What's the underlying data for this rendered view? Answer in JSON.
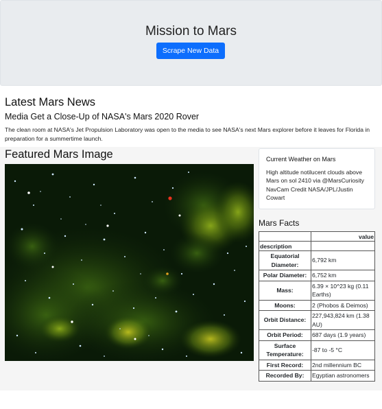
{
  "header": {
    "title": "Mission to Mars",
    "scrape_button": "Scrape New Data"
  },
  "news": {
    "heading": "Latest Mars News",
    "title": "Media Get a Close-Up of NASA's Mars 2020 Rover",
    "paragraph": "The clean room at NASA's Jet Propulsion Laboratory was open to the media to see NASA's next Mars explorer before it leaves for Florida in preparation for a summertime launch."
  },
  "featured": {
    "heading": "Featured Mars Image"
  },
  "weather": {
    "title": "Current Weather on Mars",
    "text": "High altitude notilucent clouds above Mars on sol 2410 via @MarsCuriosity NavCam Credit NASA/JPL/Justin Cowart"
  },
  "facts": {
    "heading": "Mars Facts",
    "col_value": "value",
    "col_description": "description",
    "rows": [
      {
        "label": "Equatorial Diameter:",
        "value": "6,792 km"
      },
      {
        "label": "Polar Diameter:",
        "value": "6,752 km"
      },
      {
        "label": "Mass:",
        "value": "6.39 × 10^23 kg (0.11 Earths)"
      },
      {
        "label": "Moons:",
        "value": "2 (Phobos & Deimos)"
      },
      {
        "label": "Orbit Distance:",
        "value": "227,943,824 km (1.38 AU)"
      },
      {
        "label": "Orbit Period:",
        "value": "687 days (1.9 years)"
      },
      {
        "label": "Surface Temperature:",
        "value": "-87 to -5 °C"
      },
      {
        "label": "First Record:",
        "value": "2nd millennium BC"
      },
      {
        "label": "Recorded By:",
        "value": "Egyptian astronomers"
      }
    ]
  },
  "colors": {
    "button": "#0d6efd",
    "jumbotron": "#e9ecef"
  }
}
